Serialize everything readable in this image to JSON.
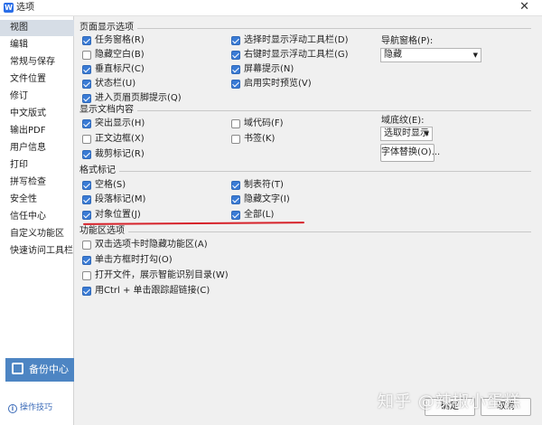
{
  "window": {
    "title": "选项",
    "app_icon": "W",
    "close_glyph": "✕"
  },
  "sidebar": {
    "items": [
      "视图",
      "编辑",
      "常规与保存",
      "文件位置",
      "修订",
      "中文版式",
      "输出PDF",
      "用户信息",
      "打印",
      "拼写检查",
      "安全性",
      "信任中心",
      "自定义功能区",
      "快速访问工具栏"
    ],
    "active_index": 0,
    "backup_label": "备份中心",
    "tips_label": "操作技巧"
  },
  "sections": {
    "page_display": {
      "title": "页面显示选项",
      "options": [
        {
          "label": "任务窗格(R)",
          "checked": true
        },
        {
          "label": "隐藏空白(B)",
          "checked": false
        },
        {
          "label": "垂直标尺(C)",
          "checked": true
        },
        {
          "label": "状态栏(U)",
          "checked": true
        },
        {
          "label": "进入页眉页脚提示(Q)",
          "checked": true
        },
        {
          "label": "选择时显示浮动工具栏(D)",
          "checked": true
        },
        {
          "label": "右键时显示浮动工具栏(G)",
          "checked": true
        },
        {
          "label": "屏幕提示(N)",
          "checked": true
        },
        {
          "label": "启用实时预览(V)",
          "checked": true
        }
      ],
      "nav_pane_label": "导航窗格(P):",
      "nav_pane_value": "隐藏"
    },
    "doc_content": {
      "title": "显示文档内容",
      "options": [
        {
          "label": "突出显示(H)",
          "checked": true
        },
        {
          "label": "正文边框(X)",
          "checked": false
        },
        {
          "label": "裁剪标记(R)",
          "checked": true
        },
        {
          "label": "域代码(F)",
          "checked": false
        },
        {
          "label": "书签(K)",
          "checked": false
        }
      ],
      "field_shading_label": "域底纹(E):",
      "field_shading_value": "选取时显示",
      "font_replace_label": "字体替换(O)..."
    },
    "format_marks": {
      "title": "格式标记",
      "options": [
        {
          "label": "空格(S)",
          "checked": true
        },
        {
          "label": "段落标记(M)",
          "checked": true
        },
        {
          "label": "对象位置(J)",
          "checked": true
        },
        {
          "label": "制表符(T)",
          "checked": true
        },
        {
          "label": "隐藏文字(I)",
          "checked": true
        },
        {
          "label": "全部(L)",
          "checked": true
        }
      ]
    },
    "ribbon": {
      "title": "功能区选项",
      "options": [
        {
          "label": "双击选项卡时隐藏功能区(A)",
          "checked": false
        },
        {
          "label": "单击方框时打勾(O)",
          "checked": true
        },
        {
          "label": "打开文件，展示智能识别目录(W)",
          "checked": false
        },
        {
          "label": "用Ctrl + 单击跟踪超链接(C)",
          "checked": true
        }
      ]
    }
  },
  "footer": {
    "ok_label": "确定",
    "cancel_label": "取消"
  },
  "watermark": "知乎 @辣椒小蛋糕"
}
